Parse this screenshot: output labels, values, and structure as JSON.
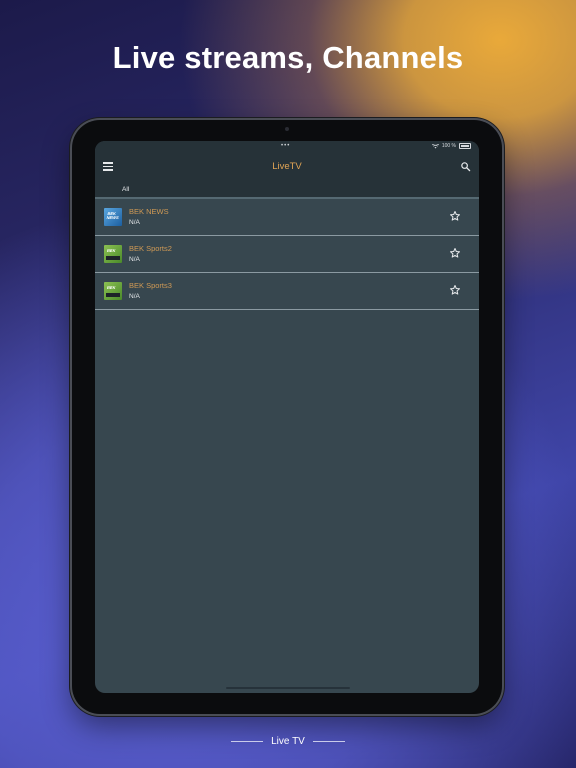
{
  "headline": "Live streams, Channels",
  "status_bar": {
    "dots": "•••",
    "battery_text": "100 %"
  },
  "toolbar": {
    "title": "LiveTV",
    "menu_icon": "hamburger-menu-icon",
    "search_icon": "search-icon"
  },
  "tabs": [
    {
      "label": "All"
    }
  ],
  "channels": [
    {
      "name": "BEK NEWS",
      "subtitle": "N/A",
      "logo": "news-logo",
      "favorite_icon": "star-outline-icon"
    },
    {
      "name": "BEK Sports2",
      "subtitle": "N/A",
      "logo": "sports-logo",
      "favorite_icon": "star-outline-icon"
    },
    {
      "name": "BEK Sports3",
      "subtitle": "N/A",
      "logo": "sports-logo",
      "favorite_icon": "star-outline-icon"
    }
  ],
  "caption": "Live TV",
  "colors": {
    "accent": "#e0a455",
    "screen_bg": "#37474f",
    "bar_bg": "#263238"
  }
}
